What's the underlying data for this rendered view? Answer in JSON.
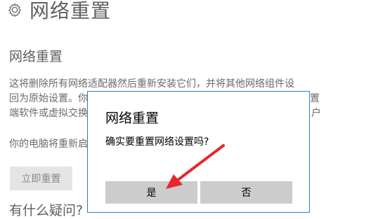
{
  "header": {
    "title": "网络重置",
    "icon": "gear-icon"
  },
  "section": {
    "title": "网络重置"
  },
  "description": {
    "lines": [
      "这将删除所有网络适配器然后重新安装它们，并将其他网络组件设",
      "回为原始设置。你",
      "端软件或虚拟交换"
    ],
    "right_fragments": [
      "置",
      "户"
    ]
  },
  "notice": "你的电脑将重新启",
  "reset_button": "立即重置",
  "question": "有什么疑问?",
  "dialog": {
    "title": "网络重置",
    "message": "确实要重置网络设置吗?",
    "yes_label": "是",
    "no_label": "否"
  },
  "colors": {
    "dialog_border": "#2b78d0",
    "arrow": "#e8262c",
    "button_bg": "#cccccc"
  }
}
